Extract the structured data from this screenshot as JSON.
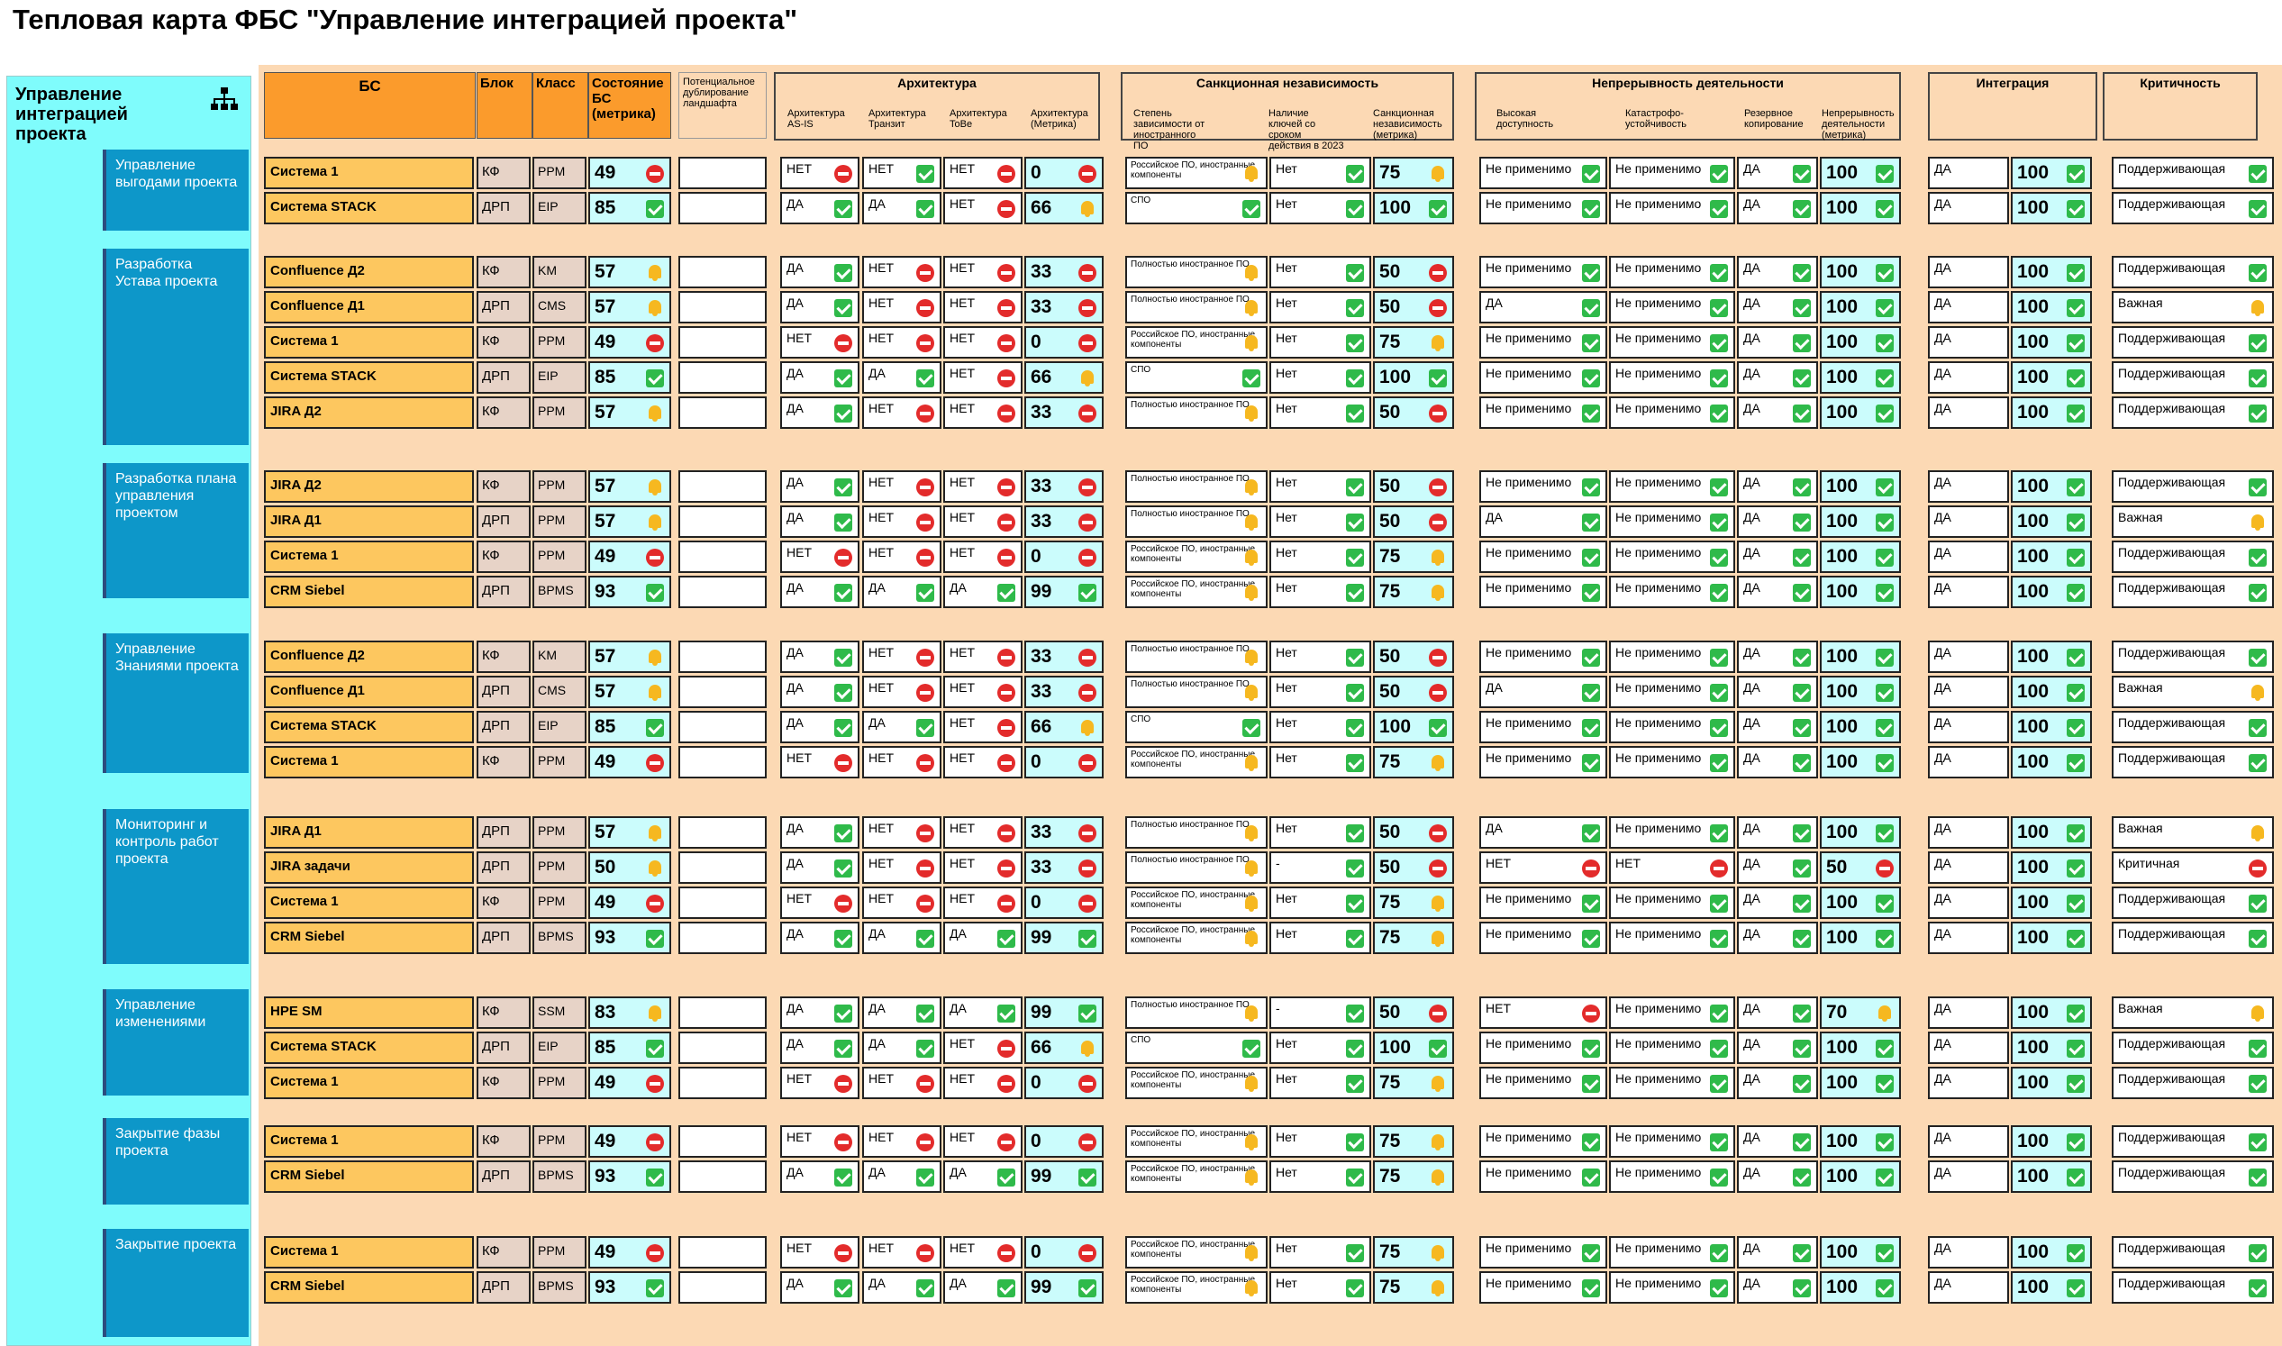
{
  "title": "Тепловая карта ФБС \"Управление интеграцией проекта\"",
  "left_title": "Управление интеграцией проекта",
  "headers": {
    "bs": "БС",
    "blok": "Блок",
    "klass": "Класс",
    "state": "Состояние БС (метрика)",
    "dup": "Потенциальное дублирование ландшафта",
    "arch": "Архитектура",
    "arch_sub": [
      "Архитектура AS-IS",
      "Архитектура Транзит",
      "Архитектура ToBe",
      "Архитектура (Метрика)"
    ],
    "sanc": "Санкционная независимость",
    "sanc_sub": [
      "Степень зависимости от иностранного ПО",
      "Наличие ключей со сроком действия в 2023",
      "Санкционная независимость (метрика)"
    ],
    "cont": "Непрерывность деятельности",
    "cont_sub": [
      "Высокая доступность",
      "Катастрофо-устойчивость",
      "Резервное копирование",
      "Непрерывность деятельности (метрика)"
    ],
    "integ": "Интеграция",
    "crit": "Критичность"
  },
  "colors": {
    "ok": "#2fba4a",
    "no": "#e32b2b",
    "warn": "#f6b820"
  },
  "groups": [
    {
      "name": "Управление выгодами проекта",
      "rows": [
        [
          "Система 1",
          "КФ",
          "PPM",
          "49",
          "no",
          "НЕТ",
          "no",
          "НЕТ",
          "ok",
          "НЕТ",
          "no",
          "0",
          "no",
          "Российское ПО, иностранные компоненты",
          "warn",
          "Нет",
          "ok",
          "75",
          "warn",
          "Не применимо",
          "ok",
          "Не применимо",
          "ok",
          "ДА",
          "ok",
          "100",
          "ok",
          "ДА",
          "ok",
          "100",
          "ok",
          "Поддерживающая",
          "ok"
        ],
        [
          "Система STACK",
          "ДРП",
          "EIP",
          "85",
          "ok",
          "ДА",
          "ok",
          "ДА",
          "ok",
          "НЕТ",
          "no",
          "66",
          "warn",
          "СПО",
          "ok",
          "Нет",
          "ok",
          "100",
          "ok",
          "Не применимо",
          "ok",
          "Не применимо",
          "ok",
          "ДА",
          "ok",
          "100",
          "ok",
          "ДА",
          "ok",
          "100",
          "ok",
          "Поддерживающая",
          "ok"
        ]
      ]
    },
    {
      "name": "Разработка Устава проекта",
      "rows": [
        [
          "Confluence Д2",
          "КФ",
          "KM",
          "57",
          "warn",
          "ДА",
          "ok",
          "НЕТ",
          "no",
          "НЕТ",
          "no",
          "33",
          "no",
          "Полностью иностранное ПО",
          "warn",
          "Нет",
          "ok",
          "50",
          "no",
          "Не применимо",
          "ok",
          "Не применимо",
          "ok",
          "ДА",
          "ok",
          "100",
          "ok",
          "ДА",
          "ok",
          "100",
          "ok",
          "Поддерживающая",
          "ok"
        ],
        [
          "Confluence Д1",
          "ДРП",
          "CMS",
          "57",
          "warn",
          "ДА",
          "ok",
          "НЕТ",
          "no",
          "НЕТ",
          "no",
          "33",
          "no",
          "Полностью иностранное ПО",
          "warn",
          "Нет",
          "ok",
          "50",
          "no",
          "ДА",
          "ok",
          "Не применимо",
          "ok",
          "ДА",
          "ok",
          "100",
          "ok",
          "ДА",
          "ok",
          "100",
          "ok",
          "Важная",
          "warn"
        ],
        [
          "Система 1",
          "КФ",
          "PPM",
          "49",
          "no",
          "НЕТ",
          "no",
          "НЕТ",
          "no",
          "НЕТ",
          "no",
          "0",
          "no",
          "Российское ПО, иностранные компоненты",
          "warn",
          "Нет",
          "ok",
          "75",
          "warn",
          "Не применимо",
          "ok",
          "Не применимо",
          "ok",
          "ДА",
          "ok",
          "100",
          "ok",
          "ДА",
          "ok",
          "100",
          "ok",
          "Поддерживающая",
          "ok"
        ],
        [
          "Система STACK",
          "ДРП",
          "EIP",
          "85",
          "ok",
          "ДА",
          "ok",
          "ДА",
          "ok",
          "НЕТ",
          "no",
          "66",
          "warn",
          "СПО",
          "ok",
          "Нет",
          "ok",
          "100",
          "ok",
          "Не применимо",
          "ok",
          "Не применимо",
          "ok",
          "ДА",
          "ok",
          "100",
          "ok",
          "ДА",
          "ok",
          "100",
          "ok",
          "Поддерживающая",
          "ok"
        ],
        [
          "JIRA Д2",
          "КФ",
          "PPM",
          "57",
          "warn",
          "ДА",
          "ok",
          "НЕТ",
          "no",
          "НЕТ",
          "no",
          "33",
          "no",
          "Полностью иностранное ПО",
          "warn",
          "Нет",
          "ok",
          "50",
          "no",
          "Не применимо",
          "ok",
          "Не применимо",
          "ok",
          "ДА",
          "ok",
          "100",
          "ok",
          "ДА",
          "ok",
          "100",
          "ok",
          "Поддерживающая",
          "ok"
        ]
      ]
    },
    {
      "name": "Разработка плана управления проектом",
      "rows": [
        [
          "JIRA Д2",
          "КФ",
          "PPM",
          "57",
          "warn",
          "ДА",
          "ok",
          "НЕТ",
          "no",
          "НЕТ",
          "no",
          "33",
          "no",
          "Полностью иностранное ПО",
          "warn",
          "Нет",
          "ok",
          "50",
          "no",
          "Не применимо",
          "ok",
          "Не применимо",
          "ok",
          "ДА",
          "ok",
          "100",
          "ok",
          "ДА",
          "ok",
          "100",
          "ok",
          "Поддерживающая",
          "ok"
        ],
        [
          "JIRA Д1",
          "ДРП",
          "PPM",
          "57",
          "warn",
          "ДА",
          "ok",
          "НЕТ",
          "no",
          "НЕТ",
          "no",
          "33",
          "no",
          "Полностью иностранное ПО",
          "warn",
          "Нет",
          "ok",
          "50",
          "no",
          "ДА",
          "ok",
          "Не применимо",
          "ok",
          "ДА",
          "ok",
          "100",
          "ok",
          "ДА",
          "ok",
          "100",
          "ok",
          "Важная",
          "warn"
        ],
        [
          "Система 1",
          "КФ",
          "PPM",
          "49",
          "no",
          "НЕТ",
          "no",
          "НЕТ",
          "no",
          "НЕТ",
          "no",
          "0",
          "no",
          "Российское ПО, иностранные компоненты",
          "warn",
          "Нет",
          "ok",
          "75",
          "warn",
          "Не применимо",
          "ok",
          "Не применимо",
          "ok",
          "ДА",
          "ok",
          "100",
          "ok",
          "ДА",
          "ok",
          "100",
          "ok",
          "Поддерживающая",
          "ok"
        ],
        [
          "CRM Siebel",
          "ДРП",
          "BPMS",
          "93",
          "ok",
          "ДА",
          "ok",
          "ДА",
          "ok",
          "ДА",
          "ok",
          "99",
          "ok",
          "Российское ПО, иностранные компоненты",
          "warn",
          "Нет",
          "ok",
          "75",
          "warn",
          "Не применимо",
          "ok",
          "Не применимо",
          "ok",
          "ДА",
          "ok",
          "100",
          "ok",
          "ДА",
          "ok",
          "100",
          "ok",
          "Поддерживающая",
          "ok"
        ]
      ]
    },
    {
      "name": "Управление Знаниями проекта",
      "rows": [
        [
          "Confluence Д2",
          "КФ",
          "KM",
          "57",
          "warn",
          "ДА",
          "ok",
          "НЕТ",
          "no",
          "НЕТ",
          "no",
          "33",
          "no",
          "Полностью иностранное ПО",
          "warn",
          "Нет",
          "ok",
          "50",
          "no",
          "Не применимо",
          "ok",
          "Не применимо",
          "ok",
          "ДА",
          "ok",
          "100",
          "ok",
          "ДА",
          "ok",
          "100",
          "ok",
          "Поддерживающая",
          "ok"
        ],
        [
          "Confluence Д1",
          "ДРП",
          "CMS",
          "57",
          "warn",
          "ДА",
          "ok",
          "НЕТ",
          "no",
          "НЕТ",
          "no",
          "33",
          "no",
          "Полностью иностранное ПО",
          "warn",
          "Нет",
          "ok",
          "50",
          "no",
          "ДА",
          "ok",
          "Не применимо",
          "ok",
          "ДА",
          "ok",
          "100",
          "ok",
          "ДА",
          "ok",
          "100",
          "ok",
          "Важная",
          "warn"
        ],
        [
          "Система STACK",
          "ДРП",
          "EIP",
          "85",
          "ok",
          "ДА",
          "ok",
          "ДА",
          "ok",
          "НЕТ",
          "no",
          "66",
          "warn",
          "СПО",
          "ok",
          "Нет",
          "ok",
          "100",
          "ok",
          "Не применимо",
          "ok",
          "Не применимо",
          "ok",
          "ДА",
          "ok",
          "100",
          "ok",
          "ДА",
          "ok",
          "100",
          "ok",
          "Поддерживающая",
          "ok"
        ],
        [
          "Система 1",
          "КФ",
          "PPM",
          "49",
          "no",
          "НЕТ",
          "no",
          "НЕТ",
          "no",
          "НЕТ",
          "no",
          "0",
          "no",
          "Российское ПО, иностранные компоненты",
          "warn",
          "Нет",
          "ok",
          "75",
          "warn",
          "Не применимо",
          "ok",
          "Не применимо",
          "ok",
          "ДА",
          "ok",
          "100",
          "ok",
          "ДА",
          "ok",
          "100",
          "ok",
          "Поддерживающая",
          "ok"
        ]
      ]
    },
    {
      "name": "Мониторинг и контроль работ проекта",
      "rows": [
        [
          "JIRA Д1",
          "ДРП",
          "PPM",
          "57",
          "warn",
          "ДА",
          "ok",
          "НЕТ",
          "no",
          "НЕТ",
          "no",
          "33",
          "no",
          "Полностью иностранное ПО",
          "warn",
          "Нет",
          "ok",
          "50",
          "no",
          "ДА",
          "ok",
          "Не применимо",
          "ok",
          "ДА",
          "ok",
          "100",
          "ok",
          "ДА",
          "ok",
          "100",
          "ok",
          "Важная",
          "warn"
        ],
        [
          "JIRA задачи",
          "ДРП",
          "PPM",
          "50",
          "warn",
          "ДА",
          "ok",
          "НЕТ",
          "no",
          "НЕТ",
          "no",
          "33",
          "no",
          "Полностью иностранное ПО",
          "warn",
          "-",
          "ok",
          "50",
          "no",
          "НЕТ",
          "no",
          "НЕТ",
          "no",
          "ДА",
          "ok",
          "50",
          "no",
          "ДА",
          "ok",
          "100",
          "ok",
          "Критичная",
          "no"
        ],
        [
          "Система 1",
          "КФ",
          "PPM",
          "49",
          "no",
          "НЕТ",
          "no",
          "НЕТ",
          "no",
          "НЕТ",
          "no",
          "0",
          "no",
          "Российское ПО, иностранные компоненты",
          "warn",
          "Нет",
          "ok",
          "75",
          "warn",
          "Не применимо",
          "ok",
          "Не применимо",
          "ok",
          "ДА",
          "ok",
          "100",
          "ok",
          "ДА",
          "ok",
          "100",
          "ok",
          "Поддерживающая",
          "ok"
        ],
        [
          "CRM Siebel",
          "ДРП",
          "BPMS",
          "93",
          "ok",
          "ДА",
          "ok",
          "ДА",
          "ok",
          "ДА",
          "ok",
          "99",
          "ok",
          "Российское ПО, иностранные компоненты",
          "warn",
          "Нет",
          "ok",
          "75",
          "warn",
          "Не применимо",
          "ok",
          "Не применимо",
          "ok",
          "ДА",
          "ok",
          "100",
          "ok",
          "ДА",
          "ok",
          "100",
          "ok",
          "Поддерживающая",
          "ok"
        ]
      ]
    },
    {
      "name": "Управление изменениями",
      "rows": [
        [
          "HPE SM",
          "КФ",
          "SSM",
          "83",
          "warn",
          "ДА",
          "ok",
          "ДА",
          "ok",
          "ДА",
          "ok",
          "99",
          "ok",
          "Полностью иностранное ПО",
          "warn",
          "-",
          "ok",
          "50",
          "no",
          "НЕТ",
          "no",
          "Не применимо",
          "ok",
          "ДА",
          "ok",
          "70",
          "warn",
          "ДА",
          "ok",
          "100",
          "ok",
          "Важная",
          "warn"
        ],
        [
          "Система STACK",
          "ДРП",
          "EIP",
          "85",
          "ok",
          "ДА",
          "ok",
          "ДА",
          "ok",
          "НЕТ",
          "no",
          "66",
          "warn",
          "СПО",
          "ok",
          "Нет",
          "ok",
          "100",
          "ok",
          "Не применимо",
          "ok",
          "Не применимо",
          "ok",
          "ДА",
          "ok",
          "100",
          "ok",
          "ДА",
          "ok",
          "100",
          "ok",
          "Поддерживающая",
          "ok"
        ],
        [
          "Система 1",
          "КФ",
          "PPM",
          "49",
          "no",
          "НЕТ",
          "no",
          "НЕТ",
          "no",
          "НЕТ",
          "no",
          "0",
          "no",
          "Российское ПО, иностранные компоненты",
          "warn",
          "Нет",
          "ok",
          "75",
          "warn",
          "Не применимо",
          "ok",
          "Не применимо",
          "ok",
          "ДА",
          "ok",
          "100",
          "ok",
          "ДА",
          "ok",
          "100",
          "ok",
          "Поддерживающая",
          "ok"
        ]
      ]
    },
    {
      "name": "Закрытие фазы проекта",
      "rows": [
        [
          "Система 1",
          "КФ",
          "PPM",
          "49",
          "no",
          "НЕТ",
          "no",
          "НЕТ",
          "no",
          "НЕТ",
          "no",
          "0",
          "no",
          "Российское ПО, иностранные компоненты",
          "warn",
          "Нет",
          "ok",
          "75",
          "warn",
          "Не применимо",
          "ok",
          "Не применимо",
          "ok",
          "ДА",
          "ok",
          "100",
          "ok",
          "ДА",
          "ok",
          "100",
          "ok",
          "Поддерживающая",
          "ok"
        ],
        [
          "CRM Siebel",
          "ДРП",
          "BPMS",
          "93",
          "ok",
          "ДА",
          "ok",
          "ДА",
          "ok",
          "ДА",
          "ok",
          "99",
          "ok",
          "Российское ПО, иностранные компоненты",
          "warn",
          "Нет",
          "ok",
          "75",
          "warn",
          "Не применимо",
          "ok",
          "Не применимо",
          "ok",
          "ДА",
          "ok",
          "100",
          "ok",
          "ДА",
          "ok",
          "100",
          "ok",
          "Поддерживающая",
          "ok"
        ]
      ]
    },
    {
      "name": "Закрытие проекта",
      "rows": [
        [
          "Система 1",
          "КФ",
          "PPM",
          "49",
          "no",
          "НЕТ",
          "no",
          "НЕТ",
          "no",
          "НЕТ",
          "no",
          "0",
          "no",
          "Российское ПО, иностранные компоненты",
          "warn",
          "Нет",
          "ok",
          "75",
          "warn",
          "Не применимо",
          "ok",
          "Не применимо",
          "ok",
          "ДА",
          "ok",
          "100",
          "ok",
          "ДА",
          "ok",
          "100",
          "ok",
          "Поддерживающая",
          "ok"
        ],
        [
          "CRM Siebel",
          "ДРП",
          "BPMS",
          "93",
          "ok",
          "ДА",
          "ok",
          "ДА",
          "ok",
          "ДА",
          "ok",
          "99",
          "ok",
          "Российское ПО, иностранные компоненты",
          "warn",
          "Нет",
          "ok",
          "75",
          "warn",
          "Не применимо",
          "ok",
          "Не применимо",
          "ok",
          "ДА",
          "ok",
          "100",
          "ok",
          "ДА",
          "ok",
          "100",
          "ok",
          "Поддерживающая",
          "ok"
        ]
      ]
    }
  ]
}
